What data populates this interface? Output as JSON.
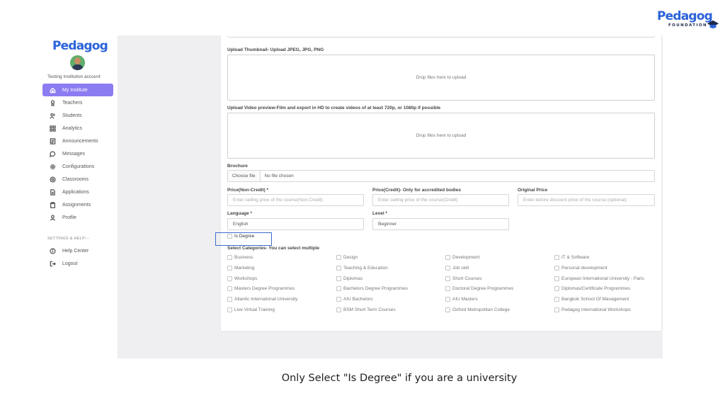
{
  "brand": {
    "name": "Pedagog",
    "subtitle": "FOUNDATION"
  },
  "sidebar": {
    "logo": "Pedagog",
    "account_name": "Testing Institution account",
    "items": [
      {
        "label": "My Institute",
        "icon": "home-icon",
        "active": true
      },
      {
        "label": "Teachers",
        "icon": "teacher-icon"
      },
      {
        "label": "Students",
        "icon": "students-icon"
      },
      {
        "label": "Analytics",
        "icon": "analytics-icon"
      },
      {
        "label": "Announcements",
        "icon": "announcement-icon"
      },
      {
        "label": "Messages",
        "icon": "message-icon"
      },
      {
        "label": "Configurations",
        "icon": "gear-icon"
      },
      {
        "label": "Classrooms",
        "icon": "classroom-icon"
      },
      {
        "label": "Applications",
        "icon": "document-icon"
      },
      {
        "label": "Assignments",
        "icon": "clipboard-icon"
      },
      {
        "label": "Profile",
        "icon": "user-icon"
      }
    ],
    "section_label": "SETTINGS & HELP---",
    "help_items": [
      {
        "label": "Help Center",
        "icon": "help-icon"
      },
      {
        "label": "Logout",
        "icon": "logout-icon"
      }
    ],
    "accent_color": "#8c7cf2"
  },
  "form": {
    "thumbnail": {
      "label": "Upload Thumbnail- Upload JPEG, JPG, PNG",
      "dropzone_text": "Drop files here to upload"
    },
    "video": {
      "label": "Upload Video preview-Film and export in HD to create videos of at least 720p, or 1080p if possible",
      "dropzone_text": "Drop files here to upload"
    },
    "brochure": {
      "label": "Brochure",
      "choose_label": "Choose file",
      "file_status": "No file chosen"
    },
    "price_noncredit": {
      "label": "Price(Non-Credit) *",
      "placeholder": "Enter selling price of the course(Non-Credit)"
    },
    "price_credit": {
      "label": "Price(Credit)- Only for accredited bodies",
      "placeholder": "Enter selling price of the course(Credit)"
    },
    "original_price": {
      "label": "Original Price",
      "placeholder": "Enter before discount price of the course (optional)"
    },
    "language": {
      "label": "Language *",
      "value": "English"
    },
    "level": {
      "label": "Level *",
      "value": "Beginner"
    },
    "is_degree": {
      "label": "Is Degree",
      "checked": false
    },
    "categories": {
      "label": "Select Categories- You can select multiple",
      "items": [
        "Business",
        "Design",
        "Development",
        "IT & Software",
        "Marketing",
        "Teaching & Education",
        "Job skill",
        "Personal development",
        "Workshops",
        "Diplomas",
        "Short Courses",
        "European International University - Paris",
        "Masters Degree Programmes",
        "Bachelors Degree Programmes",
        "Doctoral Degree Programmes",
        "Diplomas/Certificate Programmes",
        "Atlantic International University",
        "AIU Bachelors",
        "AIU Masters",
        "Bangkok School Of Management",
        "Live Virtual Training",
        "BSM Short Term Courses",
        "Oxford Metropolitan College",
        "Pedagog International Workshops"
      ]
    }
  },
  "caption": "Only Select \"Is Degree\" if you are a university",
  "highlight_color": "#3d6fd0"
}
